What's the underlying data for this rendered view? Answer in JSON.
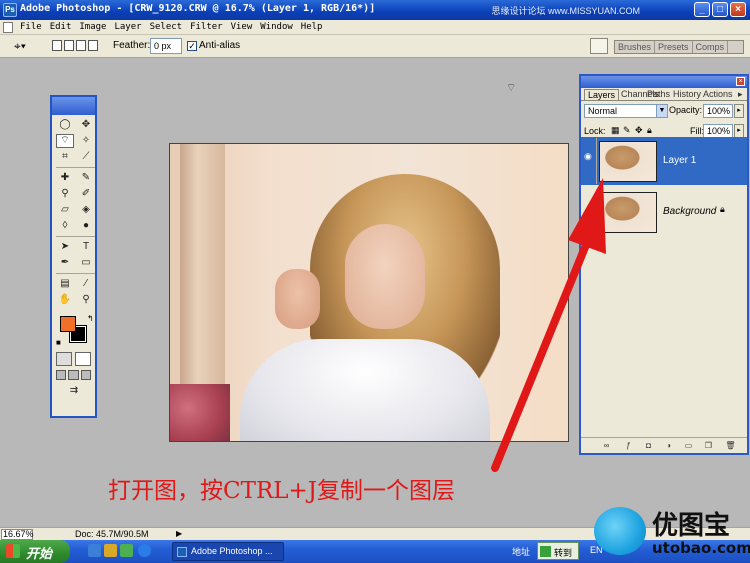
{
  "window": {
    "title": "Adobe Photoshop - [CRW_9120.CRW @ 16.7% (Layer 1, RGB/16*)]",
    "site": "思缘设计论坛 www.MISSYUAN.COM"
  },
  "menu": [
    "File",
    "Edit",
    "Image",
    "Layer",
    "Select",
    "Filter",
    "View",
    "Window",
    "Help"
  ],
  "options": {
    "feather_label": "Feather:",
    "feather_value": "0 px",
    "antialias_label": "Anti-alias",
    "palette_tabs": [
      "Brushes",
      "Presets",
      "Comps"
    ]
  },
  "layers_panel": {
    "tabs": [
      "Layers",
      "Channels",
      "Paths",
      "History",
      "Actions"
    ],
    "blend_mode": "Normal",
    "opacity_label": "Opacity:",
    "opacity": "100%",
    "lock_label": "Lock:",
    "fill_label": "Fill:",
    "fill": "100%",
    "layers": [
      {
        "name": "Layer 1",
        "selected": true
      },
      {
        "name": "Background",
        "selected": false
      }
    ]
  },
  "status": {
    "zoom": "16.67%",
    "doc": "Doc: 45.7M/90.5M"
  },
  "annotation": {
    "caption": "打开图，按CTRL+J复制一个图层",
    "color": "#e01818"
  },
  "taskbar": {
    "start": "开始",
    "task_label": "Adobe Photoshop ...",
    "address_label": "地址",
    "go_label": "转到",
    "lang": "EN"
  },
  "watermark": {
    "brand": "优图宝",
    "url": "utobao.com"
  },
  "colors": {
    "foreground": "#f07028",
    "background": "#000000"
  }
}
